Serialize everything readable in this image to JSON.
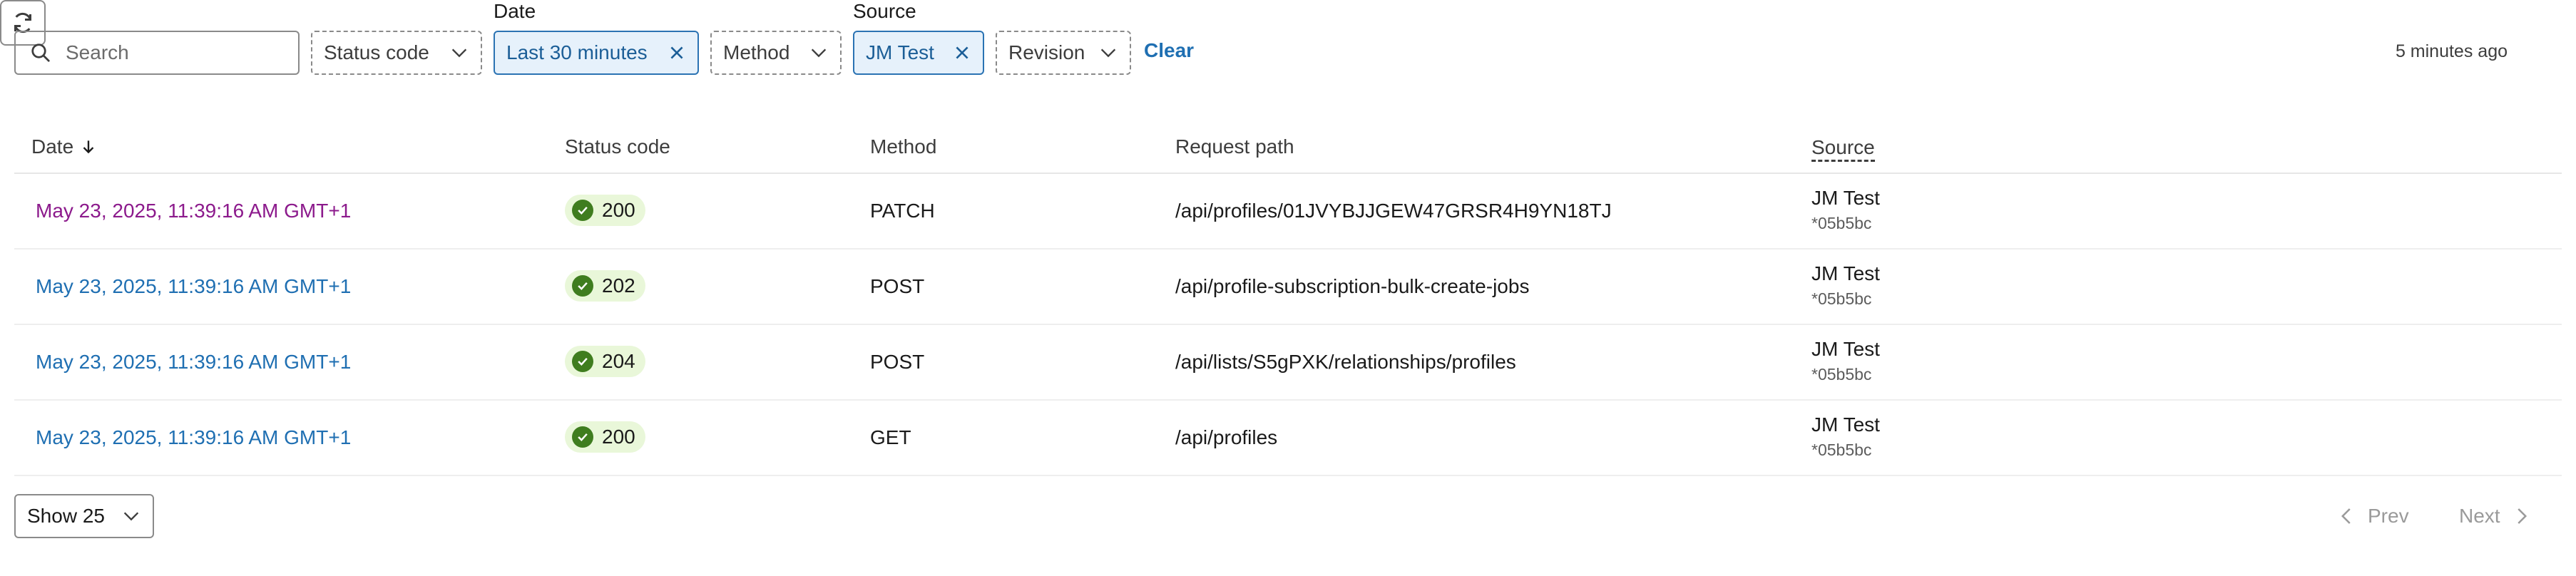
{
  "search": {
    "placeholder": "Search"
  },
  "filters": {
    "status_code": "Status code",
    "date_label": "Date",
    "date_value": "Last 30 minutes",
    "method": "Method",
    "source_label": "Source",
    "source_value": "JM Test",
    "revision": "Revision",
    "clear": "Clear"
  },
  "last_updated": "5 minutes ago",
  "table": {
    "columns": [
      "Date",
      "Status code",
      "Method",
      "Request path",
      "Source"
    ],
    "rows": [
      {
        "date": "May 23, 2025, 11:39:16 AM GMT+1",
        "status": "200",
        "method": "PATCH",
        "path": "/api/profiles/01JVYBJJGEW47GRSR4H9YN18TJ",
        "source": "JM Test",
        "revision": "*05b5bc"
      },
      {
        "date": "May 23, 2025, 11:39:16 AM GMT+1",
        "status": "202",
        "method": "POST",
        "path": "/api/profile-subscription-bulk-create-jobs",
        "source": "JM Test",
        "revision": "*05b5bc"
      },
      {
        "date": "May 23, 2025, 11:39:16 AM GMT+1",
        "status": "204",
        "method": "POST",
        "path": "/api/lists/S5gPXK/relationships/profiles",
        "source": "JM Test",
        "revision": "*05b5bc"
      },
      {
        "date": "May 23, 2025, 11:39:16 AM GMT+1",
        "status": "200",
        "method": "GET",
        "path": "/api/profiles",
        "source": "JM Test",
        "revision": "*05b5bc"
      }
    ]
  },
  "pagination": {
    "page_size": "Show 25",
    "prev": "Prev",
    "next": "Next"
  },
  "colors": {
    "link": "#1f6fb2",
    "visited_link": "#8c1a8c",
    "badge_bg": "#e9f7d9",
    "badge_check": "#3f7d1f",
    "selected_filter_bg": "#e6f1fb"
  },
  "icons": [
    "search-icon",
    "chevron-down-icon",
    "close-icon",
    "refresh-icon",
    "sort-down-arrow-icon",
    "check-circle-icon",
    "chevron-left-icon",
    "chevron-right-icon"
  ]
}
